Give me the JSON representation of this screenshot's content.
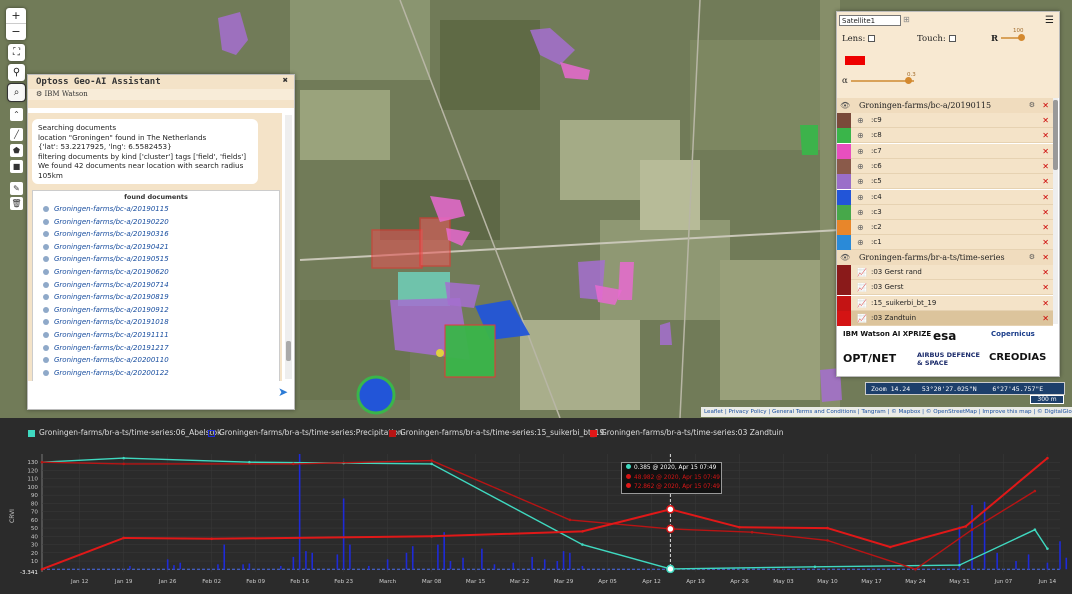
{
  "map_controls": {
    "zoom_in": "+",
    "zoom_out": "−"
  },
  "assistant": {
    "title": "Optoss Geo-AI Assistant",
    "close": "✖",
    "subtitle": "IBM Watson",
    "messages": [
      "Searching documents",
      "location \"Groningen\" found in The Netherlands",
      "{'lat': 53.2217925, 'lng': 6.5582453}",
      "filtering documents by  kind ['cluster'] tags ['field', 'fields']",
      "We found 42 documents near location with search radius 105km"
    ],
    "found_title": "found documents",
    "documents": [
      "Groningen-farms/bc-a/20190115",
      "Groningen-farms/bc-a/20190220",
      "Groningen-farms/bc-a/20190316",
      "Groningen-farms/bc-a/20190421",
      "Groningen-farms/bc-a/20190515",
      "Groningen-farms/bc-a/20190620",
      "Groningen-farms/bc-a/20190714",
      "Groningen-farms/bc-a/20190819",
      "Groningen-farms/bc-a/20190912",
      "Groningen-farms/bc-a/20191018",
      "Groningen-farms/bc-a/20191111",
      "Groningen-farms/bc-a/20191217",
      "Groningen-farms/bc-a/20200110",
      "Groningen-farms/bc-a/20200122",
      "Groningen-farms/bc-a/20200203",
      "Groningen-farms/bc-a/20200215"
    ],
    "send_icon": "➤"
  },
  "layer_panel": {
    "basemap": "Satellite1",
    "lens_label": "Lens:",
    "touch_label": "Touch:",
    "r_label": "R",
    "r_value": "100",
    "r_fraction": 1.0,
    "alpha_label": "α",
    "alpha_value": "0.3",
    "alpha_fraction": 0.9,
    "group1": "Groningen-farms/bc-a/20190115",
    "cluster_rows": [
      {
        "label": ":c9",
        "color": "#7a4a3a"
      },
      {
        "label": ":c8",
        "color": "#3ab54a"
      },
      {
        "label": ":c7",
        "color": "#e84fbf"
      },
      {
        "label": ":c6",
        "color": "#8a5a4a"
      },
      {
        "label": ":c5",
        "color": "#9a6ec9"
      },
      {
        "label": ":c4",
        "color": "#2255d8"
      },
      {
        "label": ":c3",
        "color": "#47a84a"
      },
      {
        "label": ":c2",
        "color": "#e8862a"
      },
      {
        "label": ":c1",
        "color": "#2a8ad8"
      }
    ],
    "group2": "Groningen-farms/br-a-ts/time-series",
    "series_rows": [
      {
        "label": ":03 Gerst rand",
        "color": "#8a1a1a"
      },
      {
        "label": ":03 Gerst",
        "color": "#8a1a1a"
      },
      {
        "label": ":15_suikerbi_bt_19",
        "color": "#c41414"
      },
      {
        "label": ":03 Zandtuin",
        "color": "#d41414"
      }
    ],
    "logos": [
      "IBM Watson AI XPRIZE",
      "esa",
      "Copernicus",
      "OPT/NET",
      "AIRBUS DEFENCE & SPACE",
      "CREODIAS"
    ]
  },
  "status": {
    "zoom_readout": "Zoom 14.24   53°20'27.025\"N    6°27'45.757\"E",
    "scale": "300 m",
    "attribution": "Leaflet | Privacy Policy | General Terms and Conditions | Tangram | © Mapbox | © OpenStreetMap | Improve this map | © DigitalGlobe"
  },
  "chart_data": {
    "type": "line",
    "ylabel": "CRVI",
    "y_ticks": [
      -3.341,
      10,
      20,
      30,
      40,
      50,
      60,
      70,
      80,
      90,
      100,
      110,
      120,
      130
    ],
    "ylim": [
      -3.341,
      140
    ],
    "x_ticks": [
      "Jan 12",
      "Jan 19",
      "Jan 26",
      "Feb 02",
      "Feb 09",
      "Feb 16",
      "Feb 23",
      "March",
      "Mar 08",
      "Mar 15",
      "Mar 22",
      "Mar 29",
      "Apr 05",
      "Apr 12",
      "Apr 19",
      "Apr 26",
      "May 03",
      "May 10",
      "May 17",
      "May 24",
      "May 31",
      "Jun 07",
      "Jun 14"
    ],
    "series": [
      {
        "name": "Groningen-farms/br-a-ts/time-series:06_Abelstok",
        "color": "#3fd9c0",
        "x": [
          "2020-01-06",
          "2020-01-19",
          "2020-02-08",
          "2020-02-23",
          "2020-03-08",
          "2020-04-01",
          "2020-04-15",
          "2020-05-08",
          "2020-05-31",
          "2020-06-12",
          "2020-06-14"
        ],
        "y": [
          130,
          135,
          130,
          129,
          128,
          30,
          0.385,
          3,
          5,
          48,
          25
        ]
      },
      {
        "name": "Groningen-farms/br-a-ts/time-series:Precipitation",
        "color": "#1e2ad8",
        "type": "bar"
      },
      {
        "name": "Groningen-farms/br-a-ts/time-series:15_suikerbi_bt_19",
        "color": "#b81414",
        "x": [
          "2020-01-06",
          "2020-01-19",
          "2020-02-15",
          "2020-03-08",
          "2020-03-30",
          "2020-04-15",
          "2020-04-28",
          "2020-05-10",
          "2020-05-24",
          "2020-06-02",
          "2020-06-12"
        ],
        "y": [
          130,
          128,
          128,
          132,
          60,
          48.982,
          45,
          35,
          0,
          48,
          95
        ]
      },
      {
        "name": "Groningen-farms/br-a-ts/time-series:03 Zandtuin",
        "color": "#e01818",
        "x": [
          "2020-01-06",
          "2020-01-19",
          "2020-02-02",
          "2020-03-08",
          "2020-04-01",
          "2020-04-15",
          "2020-04-26",
          "2020-05-10",
          "2020-05-20",
          "2020-06-01",
          "2020-06-14"
        ],
        "y": [
          0,
          38,
          37,
          40,
          46,
          72.862,
          51,
          50,
          27,
          52,
          135
        ]
      }
    ],
    "tooltip": [
      {
        "text": "0.385 @ 2020, Apr 15 07:49",
        "color": "#3fd9c0"
      },
      {
        "text": "48.982 @ 2020, Apr 15 07:49",
        "color": "#d41414"
      },
      {
        "text": "72.862 @ 2020, Apr 15 07:49",
        "color": "#e01818"
      }
    ]
  }
}
